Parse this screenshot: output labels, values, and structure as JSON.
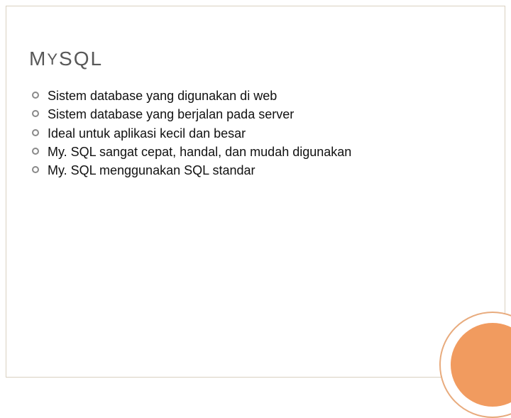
{
  "slide": {
    "title_main": "M",
    "title_small": "Y",
    "title_rest": "SQL",
    "bullets": [
      "Sistem database yang digunakan di web",
      "Sistem database yang berjalan pada server",
      "Ideal untuk aplikasi kecil dan besar",
      "My. SQL sangat cepat, handal, dan mudah digunakan",
      "My. SQL menggunakan SQL standar"
    ]
  }
}
